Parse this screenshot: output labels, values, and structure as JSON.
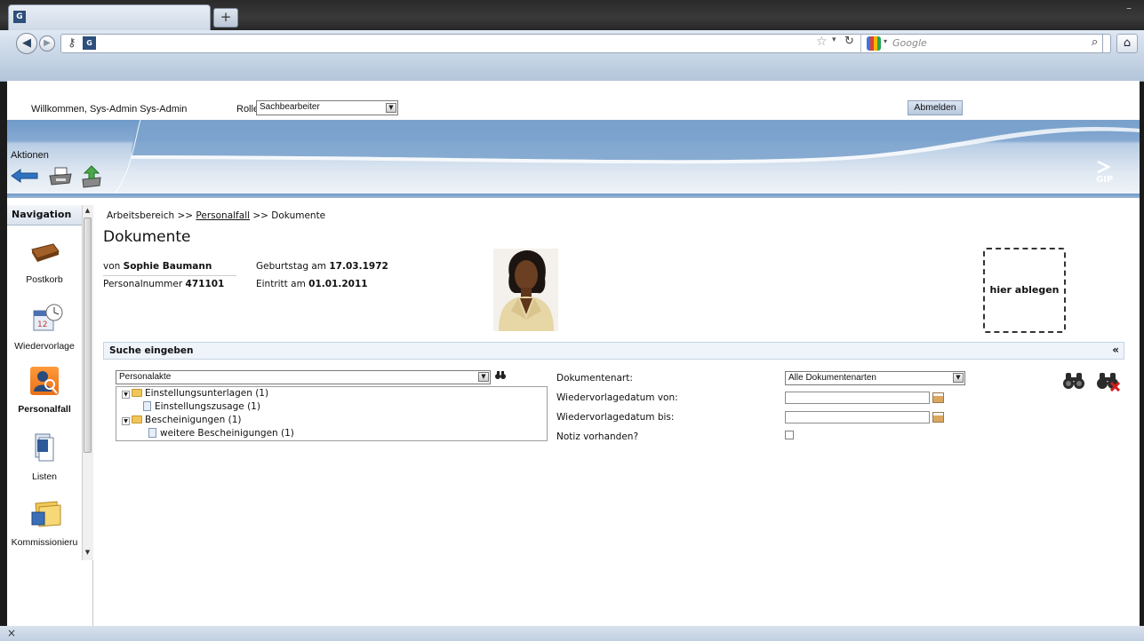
{
  "browser": {
    "newtab_symbol": "+",
    "minimize_symbol": "–",
    "search_placeholder": "Google",
    "status_close": "×"
  },
  "header": {
    "welcome": "Willkommen, Sys-Admin Sys-Admin",
    "rolle_label": "Rolle:",
    "rolle_value": "Sachbearbeiter",
    "logout": "Abmelden",
    "logo": "GIP",
    "aktionen": "Aktionen"
  },
  "navigation": {
    "title": "Navigation",
    "items": [
      {
        "label": "Postkorb",
        "icon": "inbox-tray-icon"
      },
      {
        "label": "Wiedervorlage",
        "icon": "calendar-clock-icon"
      },
      {
        "label": "Personalfall",
        "icon": "person-search-icon"
      },
      {
        "label": "Listen",
        "icon": "list-document-icon"
      },
      {
        "label": "Kommissionieru",
        "icon": "folder-box-icon"
      }
    ]
  },
  "main": {
    "breadcrumb_start": "Arbeitsbereich >> ",
    "breadcrumb_link": "Personalfall",
    "breadcrumb_end": " >> Dokumente",
    "title": "Dokumente",
    "von_prefix": "von ",
    "person_name": "Sophie Baumann",
    "geburtstag_prefix": "Geburtstag am ",
    "geburtstag": "17.03.1972",
    "personalnummer_prefix": "Personalnummer ",
    "personalnummer": "471101",
    "eintritt_prefix": "Eintritt am ",
    "eintritt": "01.01.2011",
    "drop_zone": "hier ablegen"
  },
  "search": {
    "title": "Suche eingeben",
    "collapse": "«",
    "akte_value": "Personalakte",
    "tree": [
      {
        "label": "Einstellungsunterlagen (1)",
        "type": "folder"
      },
      {
        "label": "Einstellungszusage (1)",
        "type": "doc"
      },
      {
        "label": "Bescheinigungen (1)",
        "type": "folder"
      },
      {
        "label": "weitere Bescheinigungen (1)",
        "type": "doc"
      }
    ],
    "dokumentenart_label": "Dokumentenart:",
    "dokumentenart_value": "Alle Dokumentenarten",
    "wv_von_label": "Wiedervorlagedatum von:",
    "wv_bis_label": "Wiedervorlagedatum bis:",
    "notiz_label": "Notiz vorhanden?"
  }
}
